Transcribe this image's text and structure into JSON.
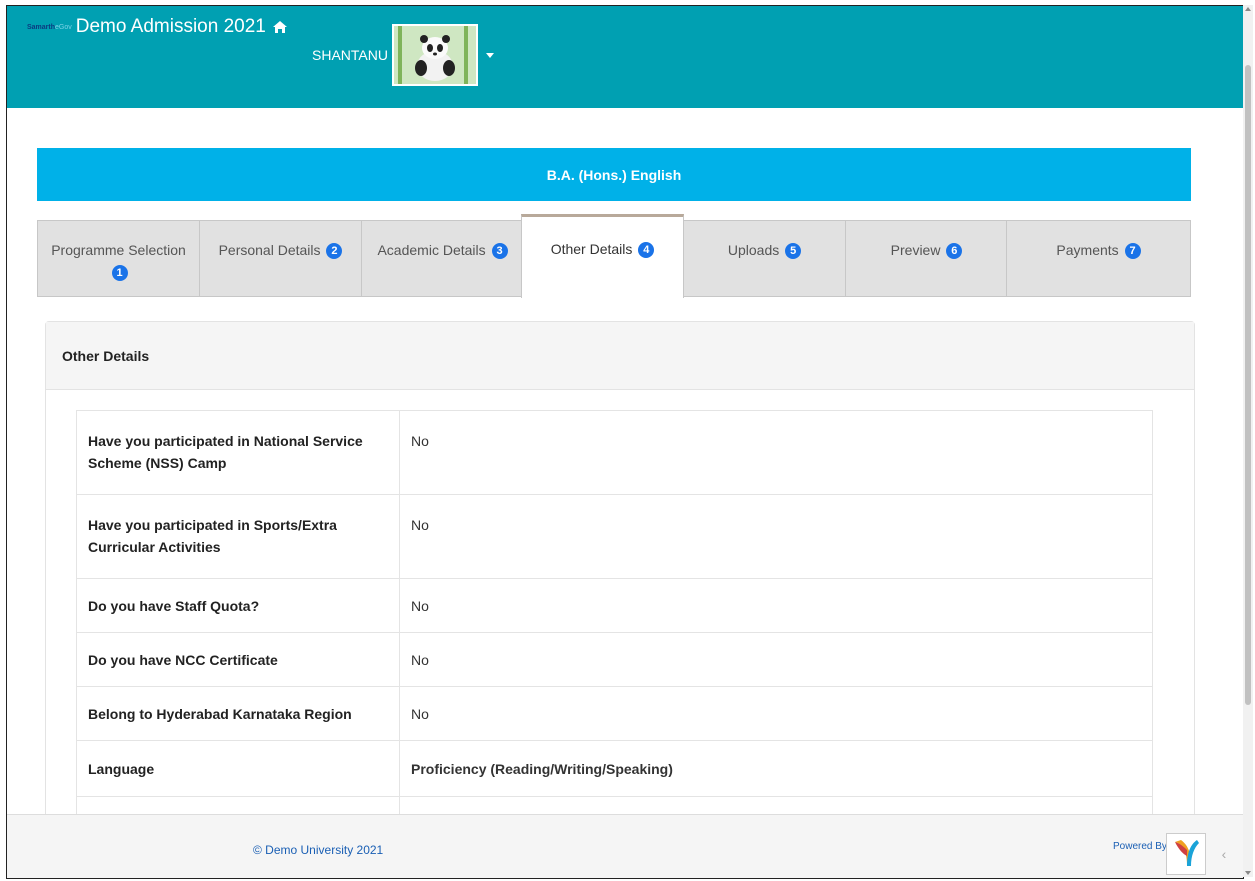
{
  "header": {
    "brand_small": "Samarth",
    "brand_small_suffix": "eGov",
    "app_title": "Demo Admission 2021",
    "user_name": "SHANTANU"
  },
  "programme": {
    "name": "B.A. (Hons.) English"
  },
  "tabs": [
    {
      "label": "Programme Selection",
      "badge": "1",
      "active": false
    },
    {
      "label": "Personal Details",
      "badge": "2",
      "active": false
    },
    {
      "label": "Academic Details",
      "badge": "3",
      "active": false
    },
    {
      "label": "Other Details",
      "badge": "4",
      "active": true
    },
    {
      "label": "Uploads",
      "badge": "5",
      "active": false
    },
    {
      "label": "Preview",
      "badge": "6",
      "active": false
    },
    {
      "label": "Payments",
      "badge": "7",
      "active": false
    }
  ],
  "panel": {
    "title": "Other Details"
  },
  "details": [
    {
      "question": "Have you participated in National Service Scheme (NSS) Camp",
      "answer": "No"
    },
    {
      "question": "Have you participated in Sports/Extra Curricular Activities",
      "answer": "No"
    },
    {
      "question": "Do you have Staff Quota?",
      "answer": "No"
    },
    {
      "question": "Do you have NCC Certificate",
      "answer": "No"
    },
    {
      "question": "Belong to Hyderabad Karnataka Region",
      "answer": "No"
    }
  ],
  "language_table": {
    "col1": "Language",
    "col2": "Proficiency (Reading/Writing/Speaking)"
  },
  "footer": {
    "copyright": "© Demo University 2021",
    "powered_by": "Powered By:"
  },
  "colors": {
    "header": "#00a0b2",
    "programme_bar": "#00b1e8",
    "badge": "#1a73e8"
  }
}
